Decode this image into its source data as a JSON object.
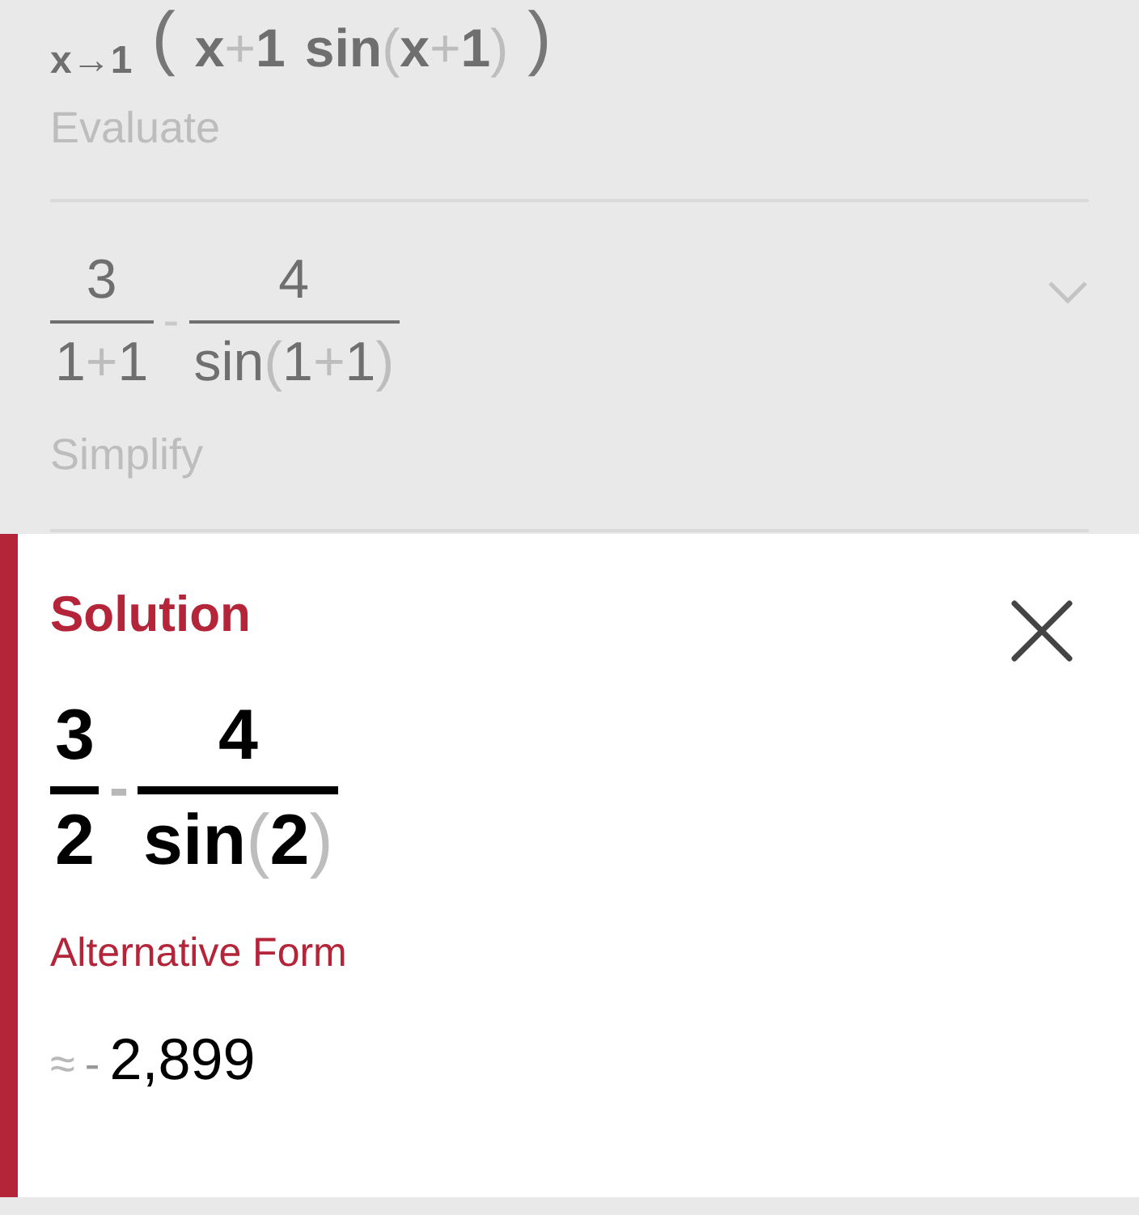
{
  "steps": [
    {
      "kind": "limit",
      "subscript": "x→1",
      "open": "(",
      "parts": [
        "x+1",
        "sin(x+1)"
      ],
      "close": ")",
      "caption": "Evaluate"
    },
    {
      "kind": "fractions",
      "fractions": [
        {
          "num": "3",
          "den": "1+1"
        },
        {
          "num": "4",
          "den": "sin(1+1)"
        }
      ],
      "operator": "-",
      "caption": "Simplify",
      "expanded": false
    }
  ],
  "solution": {
    "title": "Solution",
    "fractions": [
      {
        "num": "3",
        "den": "2"
      },
      {
        "num": "4",
        "den": "sin(2)"
      }
    ],
    "operator": "-",
    "alternative_title": "Alternative Form",
    "approx_symbol": "≈",
    "sign": "-",
    "value": "2,899"
  }
}
